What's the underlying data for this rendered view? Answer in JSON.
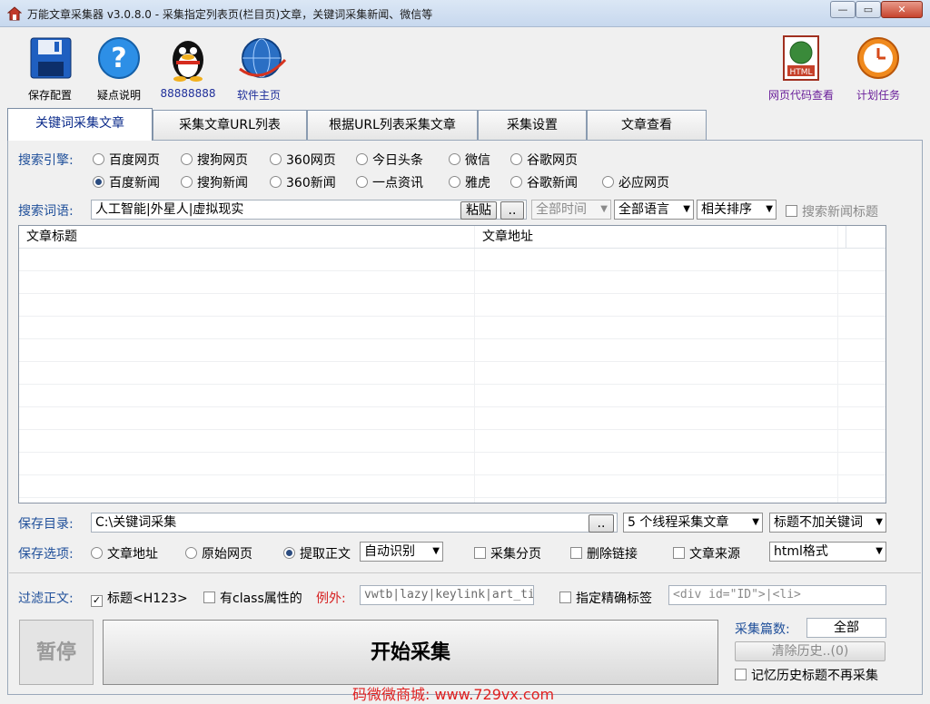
{
  "window": {
    "title": "万能文章采集器 v3.0.8.0 - 采集指定列表页(栏目页)文章，关键词采集新闻、微信等",
    "min": "—",
    "max": "▭",
    "close": "✕"
  },
  "toolbar": {
    "left": [
      {
        "label": "保存配置",
        "icon": "floppy-disk-icon"
      },
      {
        "label": "疑点说明",
        "icon": "help-question-icon"
      },
      {
        "label": "88888888",
        "icon": "qq-penguin-icon"
      },
      {
        "label": "软件主页",
        "icon": "globe-icon"
      }
    ],
    "right": [
      {
        "label": "网页代码查看",
        "icon": "html-file-icon"
      },
      {
        "label": "计划任务",
        "icon": "clock-icon"
      }
    ]
  },
  "tabs": [
    "关键词采集文章",
    "采集文章URL列表",
    "根据URL列表采集文章",
    "采集设置",
    "文章查看"
  ],
  "engine": {
    "label": "搜索引擎:",
    "row1": [
      {
        "label": "百度网页",
        "checked": false
      },
      {
        "label": "搜狗网页",
        "checked": false
      },
      {
        "label": "360网页",
        "checked": false
      },
      {
        "label": "今日头条",
        "checked": false
      },
      {
        "label": "微信",
        "checked": false
      },
      {
        "label": "谷歌网页",
        "checked": false
      }
    ],
    "row2": [
      {
        "label": "百度新闻",
        "checked": true
      },
      {
        "label": "搜狗新闻",
        "checked": false
      },
      {
        "label": "360新闻",
        "checked": false
      },
      {
        "label": "一点资讯",
        "checked": false
      },
      {
        "label": "雅虎",
        "checked": false
      },
      {
        "label": "谷歌新闻",
        "checked": false
      },
      {
        "label": "必应网页",
        "checked": false
      }
    ]
  },
  "keywords": {
    "label": "搜索词语:",
    "value": "人工智能|外星人|虚拟现实",
    "paste": "粘贴",
    "more": "..",
    "time": "全部时间",
    "lang": "全部语言",
    "sort": "相关排序",
    "news_title": "搜索新闻标题"
  },
  "grid": {
    "col1": "文章标题",
    "col2": "文章地址"
  },
  "save_dir": {
    "label": "保存目录:",
    "value": "C:\\关键词采集",
    "more": "..",
    "threads": "5 个线程采集文章",
    "title_opt": "标题不加关键词"
  },
  "save_opts": {
    "label": "保存选项:",
    "radios": [
      {
        "label": "文章地址",
        "checked": false
      },
      {
        "label": "原始网页",
        "checked": false
      },
      {
        "label": "提取正文",
        "checked": true
      }
    ],
    "detect": "自动识别",
    "checks": [
      "采集分页",
      "删除链接",
      "文章来源"
    ],
    "format": "html格式"
  },
  "filter": {
    "label": "过滤正文:",
    "title_chk": "标题<H123>",
    "class_chk": "有class属性的",
    "except": "例外:",
    "except_value": "vwtb|lazy|keylink|art_ti",
    "exact_chk": "指定精确标签",
    "exact_placeholder": "<div id=\"ID\">|<li>"
  },
  "actions": {
    "pause": "暂停",
    "start": "开始采集",
    "count_label": "采集篇数:",
    "count_value": "全部",
    "clear": "清除历史..(0)",
    "remember": "记忆历史标题不再采集"
  },
  "watermark": "码微微商城: www.729vx.com"
}
